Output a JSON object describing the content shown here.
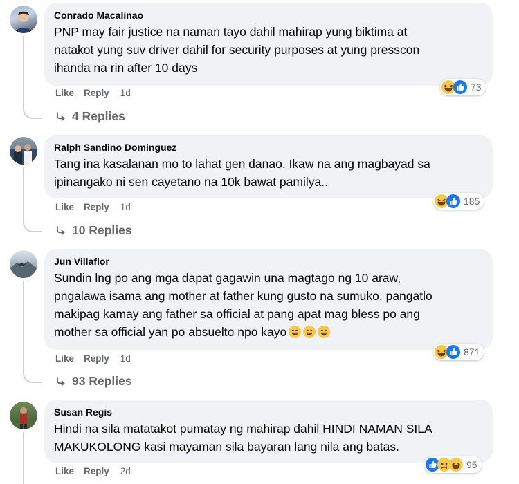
{
  "comments": [
    {
      "author": "Conrado Macalinao",
      "lines": [
        "PNP may fair justice na naman tayo dahil mahirap yung biktima at",
        "natakot yung suv driver dahil for security purposes at yung presscon",
        "ihanda na rin after 10 days"
      ],
      "like_label": "Like",
      "reply_label": "Reply",
      "time": "1d",
      "reaction_count": "73",
      "reaction_icons": [
        "haha-icon",
        "like-icon"
      ],
      "replies_label": "4 Replies"
    },
    {
      "author": "Ralph Sandino Dominguez",
      "lines": [
        "Tang ina kasalanan mo to lahat gen danao. Ikaw na ang magbayad sa",
        "ipinangako ni sen cayetano na 10k bawat pamilya.."
      ],
      "like_label": "Like",
      "reply_label": "Reply",
      "time": "1d",
      "reaction_count": "185",
      "reaction_icons": [
        "haha-icon",
        "like-icon"
      ],
      "replies_label": "10 Replies"
    },
    {
      "author": "Jun Villaflor",
      "lines": [
        "Sundin lng po ang mga dapat gagawin una magtago ng 10 araw,",
        "pngalawa isama ang mother at father kung gusto na sumuko, pangatlo",
        "makipag kamay ang father sa official at pang apat mag bless po ang",
        "mother sa official yan po absuelto npo kayo"
      ],
      "like_label": "Like",
      "reply_label": "Reply",
      "time": "1d",
      "reaction_count": "871",
      "reaction_icons": [
        "haha-icon",
        "like-icon"
      ],
      "replies_label": "93 Replies"
    },
    {
      "author": "Susan Regis",
      "lines": [
        "Hindi na sila matatakot pumatay ng mahirap dahil HINDI NAMAN SILA",
        "MAKUKOLONG kasi mayaman sila bayaran lang nila ang batas."
      ],
      "like_label": "Like",
      "reply_label": "Reply",
      "time": "2d",
      "reaction_count": "95",
      "reaction_icons": [
        "like-icon",
        "sad-icon",
        "haha-icon"
      ],
      "replies_label": ""
    }
  ],
  "colors": {
    "bubble": "#f0f2f5",
    "secondary_text": "#65676b",
    "like_blue": "#1877f2",
    "emoji_yellow": "#f7c948"
  }
}
